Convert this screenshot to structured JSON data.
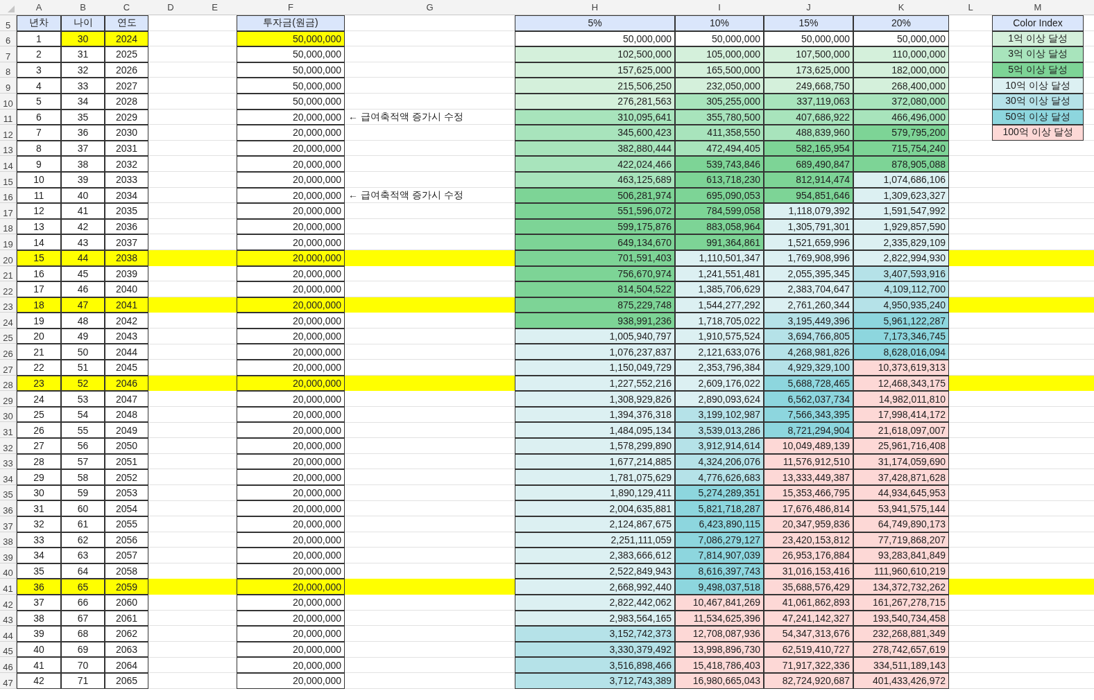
{
  "column_headers": [
    "A",
    "B",
    "C",
    "D",
    "E",
    "F",
    "G",
    "H",
    "I",
    "J",
    "K",
    "L",
    "M"
  ],
  "header_row": {
    "row": "5",
    "labels": [
      "년차",
      "나이",
      "연도"
    ],
    "principal": "투자금(원금)",
    "rates": [
      "5%",
      "10%",
      "15%",
      "20%"
    ],
    "legend_title": "Color Index"
  },
  "legend": [
    {
      "label": "1억 이상 달성",
      "color": "#d4f0db"
    },
    {
      "label": "3억 이상 달성",
      "color": "#a8e4bc"
    },
    {
      "label": "5억 이상 달성",
      "color": "#7dd496"
    },
    {
      "label": "10억 이상 달성",
      "color": "#dcf0f2"
    },
    {
      "label": "30억 이상 달성",
      "color": "#b5e2e8"
    },
    {
      "label": "50억 이상 달성",
      "color": "#8dd6de"
    },
    {
      "label": "100억 이상 달성",
      "color": "#fdd8d6"
    }
  ],
  "rows": [
    {
      "row": "6",
      "year_no": "1",
      "age": "30",
      "year": "2024",
      "principal": "50,000,000",
      "row_highlighted": false,
      "cells_highlighted": true,
      "values": [
        {
          "text": "50,000,000",
          "color": "#ffffff"
        },
        {
          "text": "50,000,000",
          "color": "#ffffff"
        },
        {
          "text": "50,000,000",
          "color": "#ffffff"
        },
        {
          "text": "50,000,000",
          "color": "#ffffff"
        }
      ]
    },
    {
      "row": "7",
      "year_no": "2",
      "age": "31",
      "year": "2025",
      "principal": "50,000,000",
      "row_highlighted": false,
      "cells_highlighted": false,
      "values": [
        {
          "text": "102,500,000",
          "color": "#d4f0db"
        },
        {
          "text": "105,000,000",
          "color": "#d4f0db"
        },
        {
          "text": "107,500,000",
          "color": "#d4f0db"
        },
        {
          "text": "110,000,000",
          "color": "#d4f0db"
        }
      ]
    },
    {
      "row": "8",
      "year_no": "3",
      "age": "32",
      "year": "2026",
      "principal": "50,000,000",
      "row_highlighted": false,
      "cells_highlighted": false,
      "values": [
        {
          "text": "157,625,000",
          "color": "#d4f0db"
        },
        {
          "text": "165,500,000",
          "color": "#d4f0db"
        },
        {
          "text": "173,625,000",
          "color": "#d4f0db"
        },
        {
          "text": "182,000,000",
          "color": "#d4f0db"
        }
      ]
    },
    {
      "row": "9",
      "year_no": "4",
      "age": "33",
      "year": "2027",
      "principal": "50,000,000",
      "row_highlighted": false,
      "cells_highlighted": false,
      "values": [
        {
          "text": "215,506,250",
          "color": "#d4f0db"
        },
        {
          "text": "232,050,000",
          "color": "#d4f0db"
        },
        {
          "text": "249,668,750",
          "color": "#d4f0db"
        },
        {
          "text": "268,400,000",
          "color": "#d4f0db"
        }
      ]
    },
    {
      "row": "10",
      "year_no": "5",
      "age": "34",
      "year": "2028",
      "principal": "50,000,000",
      "row_highlighted": false,
      "cells_highlighted": false,
      "values": [
        {
          "text": "276,281,563",
          "color": "#d4f0db"
        },
        {
          "text": "305,255,000",
          "color": "#a8e4bc"
        },
        {
          "text": "337,119,063",
          "color": "#a8e4bc"
        },
        {
          "text": "372,080,000",
          "color": "#a8e4bc"
        }
      ]
    },
    {
      "row": "11",
      "year_no": "6",
      "age": "35",
      "year": "2029",
      "principal": "20,000,000",
      "row_highlighted": false,
      "cells_highlighted": false,
      "note": "← 급여축적액 증가시 수정",
      "values": [
        {
          "text": "310,095,641",
          "color": "#a8e4bc"
        },
        {
          "text": "355,780,500",
          "color": "#a8e4bc"
        },
        {
          "text": "407,686,922",
          "color": "#a8e4bc"
        },
        {
          "text": "466,496,000",
          "color": "#a8e4bc"
        }
      ]
    },
    {
      "row": "12",
      "year_no": "7",
      "age": "36",
      "year": "2030",
      "principal": "20,000,000",
      "row_highlighted": false,
      "cells_highlighted": false,
      "values": [
        {
          "text": "345,600,423",
          "color": "#a8e4bc"
        },
        {
          "text": "411,358,550",
          "color": "#a8e4bc"
        },
        {
          "text": "488,839,960",
          "color": "#a8e4bc"
        },
        {
          "text": "579,795,200",
          "color": "#7dd496"
        }
      ]
    },
    {
      "row": "13",
      "year_no": "8",
      "age": "37",
      "year": "2031",
      "principal": "20,000,000",
      "row_highlighted": false,
      "cells_highlighted": false,
      "values": [
        {
          "text": "382,880,444",
          "color": "#a8e4bc"
        },
        {
          "text": "472,494,405",
          "color": "#a8e4bc"
        },
        {
          "text": "582,165,954",
          "color": "#7dd496"
        },
        {
          "text": "715,754,240",
          "color": "#7dd496"
        }
      ]
    },
    {
      "row": "14",
      "year_no": "9",
      "age": "38",
      "year": "2032",
      "principal": "20,000,000",
      "row_highlighted": false,
      "cells_highlighted": false,
      "values": [
        {
          "text": "422,024,466",
          "color": "#a8e4bc"
        },
        {
          "text": "539,743,846",
          "color": "#7dd496"
        },
        {
          "text": "689,490,847",
          "color": "#7dd496"
        },
        {
          "text": "878,905,088",
          "color": "#7dd496"
        }
      ]
    },
    {
      "row": "15",
      "year_no": "10",
      "age": "39",
      "year": "2033",
      "principal": "20,000,000",
      "row_highlighted": false,
      "cells_highlighted": false,
      "values": [
        {
          "text": "463,125,689",
          "color": "#a8e4bc"
        },
        {
          "text": "613,718,230",
          "color": "#7dd496"
        },
        {
          "text": "812,914,474",
          "color": "#7dd496"
        },
        {
          "text": "1,074,686,106",
          "color": "#dcf0f2"
        }
      ]
    },
    {
      "row": "16",
      "year_no": "11",
      "age": "40",
      "year": "2034",
      "principal": "20,000,000",
      "row_highlighted": false,
      "cells_highlighted": false,
      "note": "← 급여축적액 증가시 수정",
      "values": [
        {
          "text": "506,281,974",
          "color": "#7dd496"
        },
        {
          "text": "695,090,053",
          "color": "#7dd496"
        },
        {
          "text": "954,851,646",
          "color": "#7dd496"
        },
        {
          "text": "1,309,623,327",
          "color": "#dcf0f2"
        }
      ]
    },
    {
      "row": "17",
      "year_no": "12",
      "age": "41",
      "year": "2035",
      "principal": "20,000,000",
      "row_highlighted": false,
      "cells_highlighted": false,
      "values": [
        {
          "text": "551,596,072",
          "color": "#7dd496"
        },
        {
          "text": "784,599,058",
          "color": "#7dd496"
        },
        {
          "text": "1,118,079,392",
          "color": "#dcf0f2"
        },
        {
          "text": "1,591,547,992",
          "color": "#dcf0f2"
        }
      ]
    },
    {
      "row": "18",
      "year_no": "13",
      "age": "42",
      "year": "2036",
      "principal": "20,000,000",
      "row_highlighted": false,
      "cells_highlighted": false,
      "values": [
        {
          "text": "599,175,876",
          "color": "#7dd496"
        },
        {
          "text": "883,058,964",
          "color": "#7dd496"
        },
        {
          "text": "1,305,791,301",
          "color": "#dcf0f2"
        },
        {
          "text": "1,929,857,590",
          "color": "#dcf0f2"
        }
      ]
    },
    {
      "row": "19",
      "year_no": "14",
      "age": "43",
      "year": "2037",
      "principal": "20,000,000",
      "row_highlighted": false,
      "cells_highlighted": false,
      "values": [
        {
          "text": "649,134,670",
          "color": "#7dd496"
        },
        {
          "text": "991,364,861",
          "color": "#7dd496"
        },
        {
          "text": "1,521,659,996",
          "color": "#dcf0f2"
        },
        {
          "text": "2,335,829,109",
          "color": "#dcf0f2"
        }
      ]
    },
    {
      "row": "20",
      "year_no": "15",
      "age": "44",
      "year": "2038",
      "principal": "20,000,000",
      "row_highlighted": true,
      "cells_highlighted": false,
      "values": [
        {
          "text": "701,591,403",
          "color": "#7dd496"
        },
        {
          "text": "1,110,501,347",
          "color": "#dcf0f2"
        },
        {
          "text": "1,769,908,996",
          "color": "#dcf0f2"
        },
        {
          "text": "2,822,994,930",
          "color": "#dcf0f2"
        }
      ]
    },
    {
      "row": "21",
      "year_no": "16",
      "age": "45",
      "year": "2039",
      "principal": "20,000,000",
      "row_highlighted": false,
      "cells_highlighted": false,
      "values": [
        {
          "text": "756,670,974",
          "color": "#7dd496"
        },
        {
          "text": "1,241,551,481",
          "color": "#dcf0f2"
        },
        {
          "text": "2,055,395,345",
          "color": "#dcf0f2"
        },
        {
          "text": "3,407,593,916",
          "color": "#b5e2e8"
        }
      ]
    },
    {
      "row": "22",
      "year_no": "17",
      "age": "46",
      "year": "2040",
      "principal": "20,000,000",
      "row_highlighted": false,
      "cells_highlighted": false,
      "values": [
        {
          "text": "814,504,522",
          "color": "#7dd496"
        },
        {
          "text": "1,385,706,629",
          "color": "#dcf0f2"
        },
        {
          "text": "2,383,704,647",
          "color": "#dcf0f2"
        },
        {
          "text": "4,109,112,700",
          "color": "#b5e2e8"
        }
      ]
    },
    {
      "row": "23",
      "year_no": "18",
      "age": "47",
      "year": "2041",
      "principal": "20,000,000",
      "row_highlighted": true,
      "cells_highlighted": false,
      "values": [
        {
          "text": "875,229,748",
          "color": "#7dd496"
        },
        {
          "text": "1,544,277,292",
          "color": "#dcf0f2"
        },
        {
          "text": "2,761,260,344",
          "color": "#dcf0f2"
        },
        {
          "text": "4,950,935,240",
          "color": "#b5e2e8"
        }
      ]
    },
    {
      "row": "24",
      "year_no": "19",
      "age": "48",
      "year": "2042",
      "principal": "20,000,000",
      "row_highlighted": false,
      "cells_highlighted": false,
      "values": [
        {
          "text": "938,991,236",
          "color": "#7dd496"
        },
        {
          "text": "1,718,705,022",
          "color": "#dcf0f2"
        },
        {
          "text": "3,195,449,396",
          "color": "#b5e2e8"
        },
        {
          "text": "5,961,122,287",
          "color": "#8dd6de"
        }
      ]
    },
    {
      "row": "25",
      "year_no": "20",
      "age": "49",
      "year": "2043",
      "principal": "20,000,000",
      "row_highlighted": false,
      "cells_highlighted": false,
      "values": [
        {
          "text": "1,005,940,797",
          "color": "#dcf0f2"
        },
        {
          "text": "1,910,575,524",
          "color": "#dcf0f2"
        },
        {
          "text": "3,694,766,805",
          "color": "#b5e2e8"
        },
        {
          "text": "7,173,346,745",
          "color": "#8dd6de"
        }
      ]
    },
    {
      "row": "26",
      "year_no": "21",
      "age": "50",
      "year": "2044",
      "principal": "20,000,000",
      "row_highlighted": false,
      "cells_highlighted": false,
      "values": [
        {
          "text": "1,076,237,837",
          "color": "#dcf0f2"
        },
        {
          "text": "2,121,633,076",
          "color": "#dcf0f2"
        },
        {
          "text": "4,268,981,826",
          "color": "#b5e2e8"
        },
        {
          "text": "8,628,016,094",
          "color": "#8dd6de"
        }
      ]
    },
    {
      "row": "27",
      "year_no": "22",
      "age": "51",
      "year": "2045",
      "principal": "20,000,000",
      "row_highlighted": false,
      "cells_highlighted": false,
      "values": [
        {
          "text": "1,150,049,729",
          "color": "#dcf0f2"
        },
        {
          "text": "2,353,796,384",
          "color": "#dcf0f2"
        },
        {
          "text": "4,929,329,100",
          "color": "#b5e2e8"
        },
        {
          "text": "10,373,619,313",
          "color": "#fdd8d6"
        }
      ]
    },
    {
      "row": "28",
      "year_no": "23",
      "age": "52",
      "year": "2046",
      "principal": "20,000,000",
      "row_highlighted": true,
      "cells_highlighted": false,
      "values": [
        {
          "text": "1,227,552,216",
          "color": "#dcf0f2"
        },
        {
          "text": "2,609,176,022",
          "color": "#dcf0f2"
        },
        {
          "text": "5,688,728,465",
          "color": "#8dd6de"
        },
        {
          "text": "12,468,343,175",
          "color": "#fdd8d6"
        }
      ]
    },
    {
      "row": "29",
      "year_no": "24",
      "age": "53",
      "year": "2047",
      "principal": "20,000,000",
      "row_highlighted": false,
      "cells_highlighted": false,
      "values": [
        {
          "text": "1,308,929,826",
          "color": "#dcf0f2"
        },
        {
          "text": "2,890,093,624",
          "color": "#dcf0f2"
        },
        {
          "text": "6,562,037,734",
          "color": "#8dd6de"
        },
        {
          "text": "14,982,011,810",
          "color": "#fdd8d6"
        }
      ]
    },
    {
      "row": "30",
      "year_no": "25",
      "age": "54",
      "year": "2048",
      "principal": "20,000,000",
      "row_highlighted": false,
      "cells_highlighted": false,
      "values": [
        {
          "text": "1,394,376,318",
          "color": "#dcf0f2"
        },
        {
          "text": "3,199,102,987",
          "color": "#b5e2e8"
        },
        {
          "text": "7,566,343,395",
          "color": "#8dd6de"
        },
        {
          "text": "17,998,414,172",
          "color": "#fdd8d6"
        }
      ]
    },
    {
      "row": "31",
      "year_no": "26",
      "age": "55",
      "year": "2049",
      "principal": "20,000,000",
      "row_highlighted": false,
      "cells_highlighted": false,
      "values": [
        {
          "text": "1,484,095,134",
          "color": "#dcf0f2"
        },
        {
          "text": "3,539,013,286",
          "color": "#b5e2e8"
        },
        {
          "text": "8,721,294,904",
          "color": "#8dd6de"
        },
        {
          "text": "21,618,097,007",
          "color": "#fdd8d6"
        }
      ]
    },
    {
      "row": "32",
      "year_no": "27",
      "age": "56",
      "year": "2050",
      "principal": "20,000,000",
      "row_highlighted": false,
      "cells_highlighted": false,
      "values": [
        {
          "text": "1,578,299,890",
          "color": "#dcf0f2"
        },
        {
          "text": "3,912,914,614",
          "color": "#b5e2e8"
        },
        {
          "text": "10,049,489,139",
          "color": "#fdd8d6"
        },
        {
          "text": "25,961,716,408",
          "color": "#fdd8d6"
        }
      ]
    },
    {
      "row": "33",
      "year_no": "28",
      "age": "57",
      "year": "2051",
      "principal": "20,000,000",
      "row_highlighted": false,
      "cells_highlighted": false,
      "values": [
        {
          "text": "1,677,214,885",
          "color": "#dcf0f2"
        },
        {
          "text": "4,324,206,076",
          "color": "#b5e2e8"
        },
        {
          "text": "11,576,912,510",
          "color": "#fdd8d6"
        },
        {
          "text": "31,174,059,690",
          "color": "#fdd8d6"
        }
      ]
    },
    {
      "row": "34",
      "year_no": "29",
      "age": "58",
      "year": "2052",
      "principal": "20,000,000",
      "row_highlighted": false,
      "cells_highlighted": false,
      "values": [
        {
          "text": "1,781,075,629",
          "color": "#dcf0f2"
        },
        {
          "text": "4,776,626,683",
          "color": "#b5e2e8"
        },
        {
          "text": "13,333,449,387",
          "color": "#fdd8d6"
        },
        {
          "text": "37,428,871,628",
          "color": "#fdd8d6"
        }
      ]
    },
    {
      "row": "35",
      "year_no": "30",
      "age": "59",
      "year": "2053",
      "principal": "20,000,000",
      "row_highlighted": false,
      "cells_highlighted": false,
      "values": [
        {
          "text": "1,890,129,411",
          "color": "#dcf0f2"
        },
        {
          "text": "5,274,289,351",
          "color": "#8dd6de"
        },
        {
          "text": "15,353,466,795",
          "color": "#fdd8d6"
        },
        {
          "text": "44,934,645,953",
          "color": "#fdd8d6"
        }
      ]
    },
    {
      "row": "36",
      "year_no": "31",
      "age": "60",
      "year": "2054",
      "principal": "20,000,000",
      "row_highlighted": false,
      "cells_highlighted": false,
      "values": [
        {
          "text": "2,004,635,881",
          "color": "#dcf0f2"
        },
        {
          "text": "5,821,718,287",
          "color": "#8dd6de"
        },
        {
          "text": "17,676,486,814",
          "color": "#fdd8d6"
        },
        {
          "text": "53,941,575,144",
          "color": "#fdd8d6"
        }
      ]
    },
    {
      "row": "37",
      "year_no": "32",
      "age": "61",
      "year": "2055",
      "principal": "20,000,000",
      "row_highlighted": false,
      "cells_highlighted": false,
      "values": [
        {
          "text": "2,124,867,675",
          "color": "#dcf0f2"
        },
        {
          "text": "6,423,890,115",
          "color": "#8dd6de"
        },
        {
          "text": "20,347,959,836",
          "color": "#fdd8d6"
        },
        {
          "text": "64,749,890,173",
          "color": "#fdd8d6"
        }
      ]
    },
    {
      "row": "38",
      "year_no": "33",
      "age": "62",
      "year": "2056",
      "principal": "20,000,000",
      "row_highlighted": false,
      "cells_highlighted": false,
      "values": [
        {
          "text": "2,251,111,059",
          "color": "#dcf0f2"
        },
        {
          "text": "7,086,279,127",
          "color": "#8dd6de"
        },
        {
          "text": "23,420,153,812",
          "color": "#fdd8d6"
        },
        {
          "text": "77,719,868,207",
          "color": "#fdd8d6"
        }
      ]
    },
    {
      "row": "39",
      "year_no": "34",
      "age": "63",
      "year": "2057",
      "principal": "20,000,000",
      "row_highlighted": false,
      "cells_highlighted": false,
      "values": [
        {
          "text": "2,383,666,612",
          "color": "#dcf0f2"
        },
        {
          "text": "7,814,907,039",
          "color": "#8dd6de"
        },
        {
          "text": "26,953,176,884",
          "color": "#fdd8d6"
        },
        {
          "text": "93,283,841,849",
          "color": "#fdd8d6"
        }
      ]
    },
    {
      "row": "40",
      "year_no": "35",
      "age": "64",
      "year": "2058",
      "principal": "20,000,000",
      "row_highlighted": false,
      "cells_highlighted": false,
      "values": [
        {
          "text": "2,522,849,943",
          "color": "#dcf0f2"
        },
        {
          "text": "8,616,397,743",
          "color": "#8dd6de"
        },
        {
          "text": "31,016,153,416",
          "color": "#fdd8d6"
        },
        {
          "text": "111,960,610,219",
          "color": "#fdd8d6"
        }
      ]
    },
    {
      "row": "41",
      "year_no": "36",
      "age": "65",
      "year": "2059",
      "principal": "20,000,000",
      "row_highlighted": true,
      "cells_highlighted": false,
      "values": [
        {
          "text": "2,668,992,440",
          "color": "#dcf0f2"
        },
        {
          "text": "9,498,037,518",
          "color": "#8dd6de"
        },
        {
          "text": "35,688,576,429",
          "color": "#fdd8d6"
        },
        {
          "text": "134,372,732,262",
          "color": "#fdd8d6"
        }
      ]
    },
    {
      "row": "42",
      "year_no": "37",
      "age": "66",
      "year": "2060",
      "principal": "20,000,000",
      "row_highlighted": false,
      "cells_highlighted": false,
      "values": [
        {
          "text": "2,822,442,062",
          "color": "#dcf0f2"
        },
        {
          "text": "10,467,841,269",
          "color": "#fdd8d6"
        },
        {
          "text": "41,061,862,893",
          "color": "#fdd8d6"
        },
        {
          "text": "161,267,278,715",
          "color": "#fdd8d6"
        }
      ]
    },
    {
      "row": "43",
      "year_no": "38",
      "age": "67",
      "year": "2061",
      "principal": "20,000,000",
      "row_highlighted": false,
      "cells_highlighted": false,
      "values": [
        {
          "text": "2,983,564,165",
          "color": "#dcf0f2"
        },
        {
          "text": "11,534,625,396",
          "color": "#fdd8d6"
        },
        {
          "text": "47,241,142,327",
          "color": "#fdd8d6"
        },
        {
          "text": "193,540,734,458",
          "color": "#fdd8d6"
        }
      ]
    },
    {
      "row": "44",
      "year_no": "39",
      "age": "68",
      "year": "2062",
      "principal": "20,000,000",
      "row_highlighted": false,
      "cells_highlighted": false,
      "values": [
        {
          "text": "3,152,742,373",
          "color": "#b5e2e8"
        },
        {
          "text": "12,708,087,936",
          "color": "#fdd8d6"
        },
        {
          "text": "54,347,313,676",
          "color": "#fdd8d6"
        },
        {
          "text": "232,268,881,349",
          "color": "#fdd8d6"
        }
      ]
    },
    {
      "row": "45",
      "year_no": "40",
      "age": "69",
      "year": "2063",
      "principal": "20,000,000",
      "row_highlighted": false,
      "cells_highlighted": false,
      "values": [
        {
          "text": "3,330,379,492",
          "color": "#b5e2e8"
        },
        {
          "text": "13,998,896,730",
          "color": "#fdd8d6"
        },
        {
          "text": "62,519,410,727",
          "color": "#fdd8d6"
        },
        {
          "text": "278,742,657,619",
          "color": "#fdd8d6"
        }
      ]
    },
    {
      "row": "46",
      "year_no": "41",
      "age": "70",
      "year": "2064",
      "principal": "20,000,000",
      "row_highlighted": false,
      "cells_highlighted": false,
      "values": [
        {
          "text": "3,516,898,466",
          "color": "#b5e2e8"
        },
        {
          "text": "15,418,786,403",
          "color": "#fdd8d6"
        },
        {
          "text": "71,917,322,336",
          "color": "#fdd8d6"
        },
        {
          "text": "334,511,189,143",
          "color": "#fdd8d6"
        }
      ]
    },
    {
      "row": "47",
      "year_no": "42",
      "age": "71",
      "year": "2065",
      "principal": "20,000,000",
      "row_highlighted": false,
      "cells_highlighted": false,
      "values": [
        {
          "text": "3,712,743,389",
          "color": "#b5e2e8"
        },
        {
          "text": "16,980,665,043",
          "color": "#fdd8d6"
        },
        {
          "text": "82,724,920,687",
          "color": "#fdd8d6"
        },
        {
          "text": "401,433,426,972",
          "color": "#fdd8d6"
        }
      ]
    }
  ]
}
